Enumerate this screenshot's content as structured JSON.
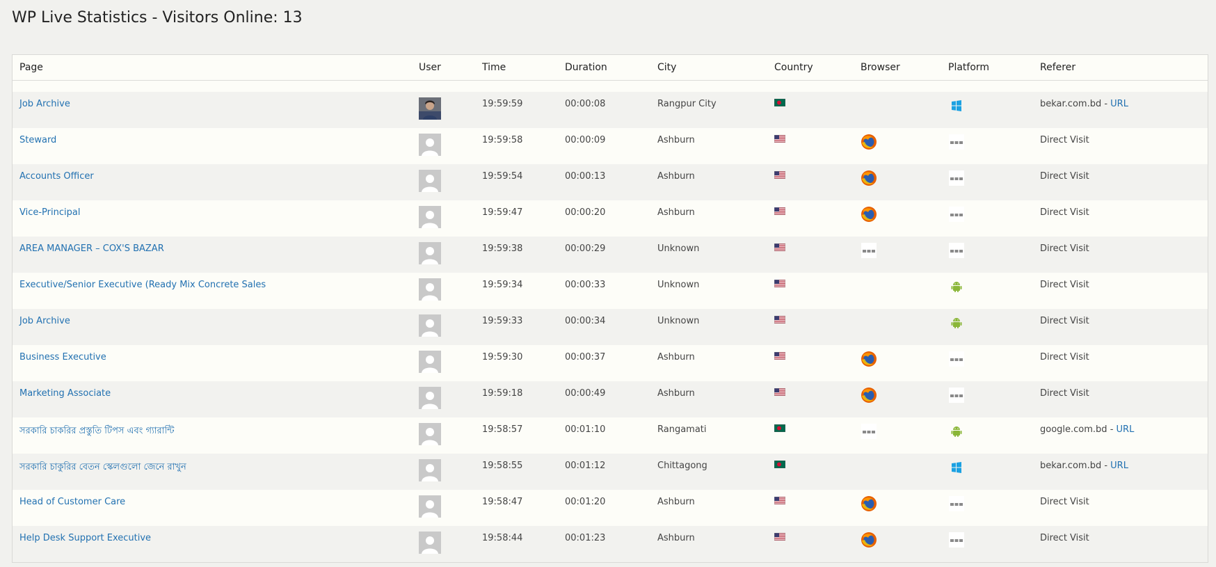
{
  "page": {
    "title": "WP Live Statistics - Visitors Online: 13"
  },
  "columns": [
    "Page",
    "User",
    "Time",
    "Duration",
    "City",
    "Country",
    "Browser",
    "Platform",
    "Referer"
  ],
  "rows": [
    {
      "page": "Job Archive",
      "user": "photo",
      "time": "19:59:59",
      "duration": "00:00:08",
      "city": "Rangpur City",
      "country": "bangladesh-flag",
      "browser": "",
      "platform": "windows-icon",
      "referer_text": "bekar.com.bd",
      "referer_link": "URL"
    },
    {
      "page": "Steward",
      "user": "default",
      "time": "19:59:58",
      "duration": "00:00:09",
      "city": "Ashburn",
      "country": "usa-flag",
      "browser": "firefox-icon",
      "platform": "unknown-icon",
      "referer_text": "Direct Visit",
      "referer_link": ""
    },
    {
      "page": "Accounts Officer",
      "user": "default",
      "time": "19:59:54",
      "duration": "00:00:13",
      "city": "Ashburn",
      "country": "usa-flag",
      "browser": "firefox-icon",
      "platform": "unknown-icon",
      "referer_text": "Direct Visit",
      "referer_link": ""
    },
    {
      "page": "Vice-Principal",
      "user": "default",
      "time": "19:59:47",
      "duration": "00:00:20",
      "city": "Ashburn",
      "country": "usa-flag",
      "browser": "firefox-icon",
      "platform": "unknown-icon",
      "referer_text": "Direct Visit",
      "referer_link": ""
    },
    {
      "page": "AREA MANAGER – COX'S BAZAR",
      "user": "default",
      "time": "19:59:38",
      "duration": "00:00:29",
      "city": "Unknown",
      "country": "usa-flag",
      "browser": "unknown-icon",
      "platform": "unknown-icon",
      "referer_text": "Direct Visit",
      "referer_link": ""
    },
    {
      "page": "Executive/Senior Executive (Ready Mix Concrete Sales",
      "user": "default",
      "time": "19:59:34",
      "duration": "00:00:33",
      "city": "Unknown",
      "country": "usa-flag",
      "browser": "",
      "platform": "android-icon",
      "referer_text": "Direct Visit",
      "referer_link": ""
    },
    {
      "page": "Job Archive",
      "user": "default",
      "time": "19:59:33",
      "duration": "00:00:34",
      "city": "Unknown",
      "country": "usa-flag",
      "browser": "",
      "platform": "android-icon",
      "referer_text": "Direct Visit",
      "referer_link": ""
    },
    {
      "page": "Business Executive",
      "user": "default",
      "time": "19:59:30",
      "duration": "00:00:37",
      "city": "Ashburn",
      "country": "usa-flag",
      "browser": "firefox-icon",
      "platform": "unknown-icon",
      "referer_text": "Direct Visit",
      "referer_link": ""
    },
    {
      "page": "Marketing Associate",
      "user": "default",
      "time": "19:59:18",
      "duration": "00:00:49",
      "city": "Ashburn",
      "country": "usa-flag",
      "browser": "firefox-icon",
      "platform": "unknown-icon",
      "referer_text": "Direct Visit",
      "referer_link": ""
    },
    {
      "page": "সরকারি চাকরির প্রস্তুতি টিপস এবং গ্যারান্টি",
      "user": "default",
      "time": "19:58:57",
      "duration": "00:01:10",
      "city": "Rangamati",
      "country": "bangladesh-flag",
      "browser": "unknown-icon",
      "platform": "android-icon",
      "referer_text": "google.com.bd",
      "referer_link": "URL"
    },
    {
      "page": "সরকারি চাকুরির বেতন স্কেলগুলো জেনে রাখুন",
      "user": "default",
      "time": "19:58:55",
      "duration": "00:01:12",
      "city": "Chittagong",
      "country": "bangladesh-flag",
      "browser": "",
      "platform": "windows-icon",
      "referer_text": "bekar.com.bd",
      "referer_link": "URL"
    },
    {
      "page": "Head of Customer Care",
      "user": "default",
      "time": "19:58:47",
      "duration": "00:01:20",
      "city": "Ashburn",
      "country": "usa-flag",
      "browser": "firefox-icon",
      "platform": "unknown-icon",
      "referer_text": "Direct Visit",
      "referer_link": ""
    },
    {
      "page": "Help Desk Support Executive",
      "user": "default",
      "time": "19:58:44",
      "duration": "00:01:23",
      "city": "Ashburn",
      "country": "usa-flag",
      "browser": "firefox-icon",
      "platform": "unknown-icon",
      "referer_text": "Direct Visit",
      "referer_link": ""
    }
  ],
  "colors": {
    "link": "#2271b1",
    "background": "#f1f1ee",
    "row_alt": "#f2f2ef",
    "row": "#fdfdf8"
  }
}
